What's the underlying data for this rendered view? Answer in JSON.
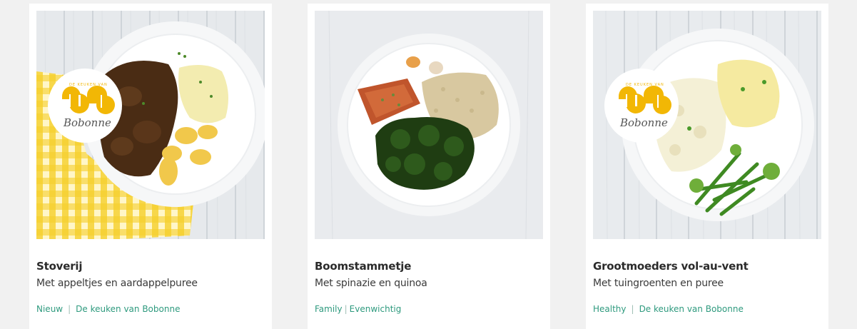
{
  "cards": [
    {
      "title": "Stoverij",
      "subtitle": "Met appeltjes en aardappelpuree",
      "tags": [
        "Nieuw",
        "De keuken van Bobonne"
      ],
      "badge": {
        "small_text": "DE KEUKEN VAN",
        "script_text": "Bobonne",
        "color": "#f2b705"
      }
    },
    {
      "title": "Boomstammetje",
      "subtitle": "Met spinazie en quinoa",
      "tags": [
        "Family",
        "Evenwichtig"
      ]
    },
    {
      "title": "Grootmoeders vol-au-vent",
      "subtitle": "Met tuingroenten en puree",
      "tags": [
        "Healthy",
        "De keuken van Bobonne"
      ],
      "badge": {
        "small_text": "DE KEUKEN VAN",
        "script_text": "Bobonne",
        "color": "#f2b705"
      }
    }
  ],
  "separator": "|",
  "colors": {
    "tag": "#2e9a7e",
    "title": "#2b2b2b",
    "background": "#f1f1f1"
  }
}
